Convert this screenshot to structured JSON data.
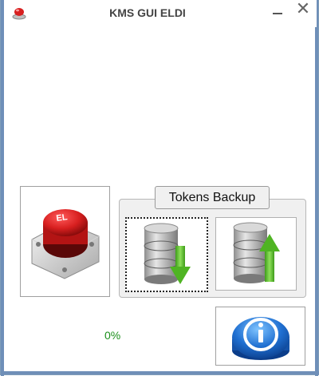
{
  "window": {
    "title": "KMS GUI ELDI",
    "app_icon": "red-button-icon",
    "close_glyph": "✕"
  },
  "main_button": {
    "label": "EL",
    "icon": "red-push-button-icon"
  },
  "tokens_backup": {
    "title": "Tokens Backup",
    "backup_icon": "database-download-icon",
    "restore_icon": "database-upload-icon"
  },
  "progress": {
    "text": "0%"
  },
  "info_button": {
    "icon": "info-icon"
  },
  "colors": {
    "frame": "#6f8fb8",
    "percent_text": "#1b8f1b",
    "button_red": "#d71f1f",
    "arrow_green": "#5fbd2b",
    "info_blue": "#1f6fd1"
  }
}
